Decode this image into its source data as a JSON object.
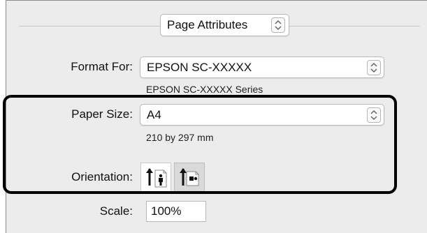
{
  "header": {
    "mode_popup_value": "Page Attributes"
  },
  "format_for": {
    "label": "Format For:",
    "value": "EPSON SC-XXXXX",
    "detail": "EPSON SC-XXXXX Series"
  },
  "paper_size": {
    "label": "Paper Size:",
    "value": "A4",
    "detail": "210 by 297 mm"
  },
  "orientation": {
    "label": "Orientation:",
    "options": [
      {
        "icon": "portrait-orientation-icon",
        "selected": false
      },
      {
        "icon": "landscape-orientation-icon",
        "selected": true
      }
    ]
  },
  "scale": {
    "label": "Scale:",
    "value": "100%"
  },
  "colors": {
    "dialog_bg": "#ececec",
    "highlight_border": "#000000"
  }
}
